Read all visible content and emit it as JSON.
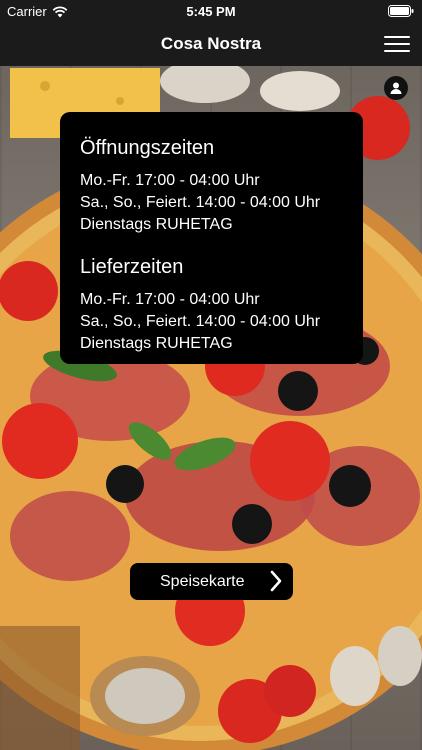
{
  "status_bar": {
    "carrier": "Carrier",
    "time": "5:45 PM"
  },
  "nav": {
    "title": "Cosa Nostra"
  },
  "opening_hours": {
    "title": "Öffnungszeiten",
    "lines": [
      "Mo.-Fr. 17:00 - 04:00 Uhr",
      "Sa., So., Feiert. 14:00 - 04:00 Uhr",
      "Dienstags RUHETAG"
    ]
  },
  "delivery_hours": {
    "title": "Lieferzeiten",
    "lines": [
      "Mo.-Fr. 17:00 - 04:00 Uhr",
      "Sa., So., Feiert. 14:00 - 04:00 Uhr",
      "Dienstags RUHETAG"
    ]
  },
  "menu_button": {
    "label": "Speisekarte"
  },
  "icons": {
    "wifi": "wifi-icon",
    "battery": "battery-icon",
    "menu": "hamburger-menu-icon",
    "profile": "user-profile-icon",
    "chevron": "chevron-right-icon"
  },
  "colors": {
    "bar": "#1b1b1b",
    "card": "#000000",
    "text": "#ffffff"
  }
}
